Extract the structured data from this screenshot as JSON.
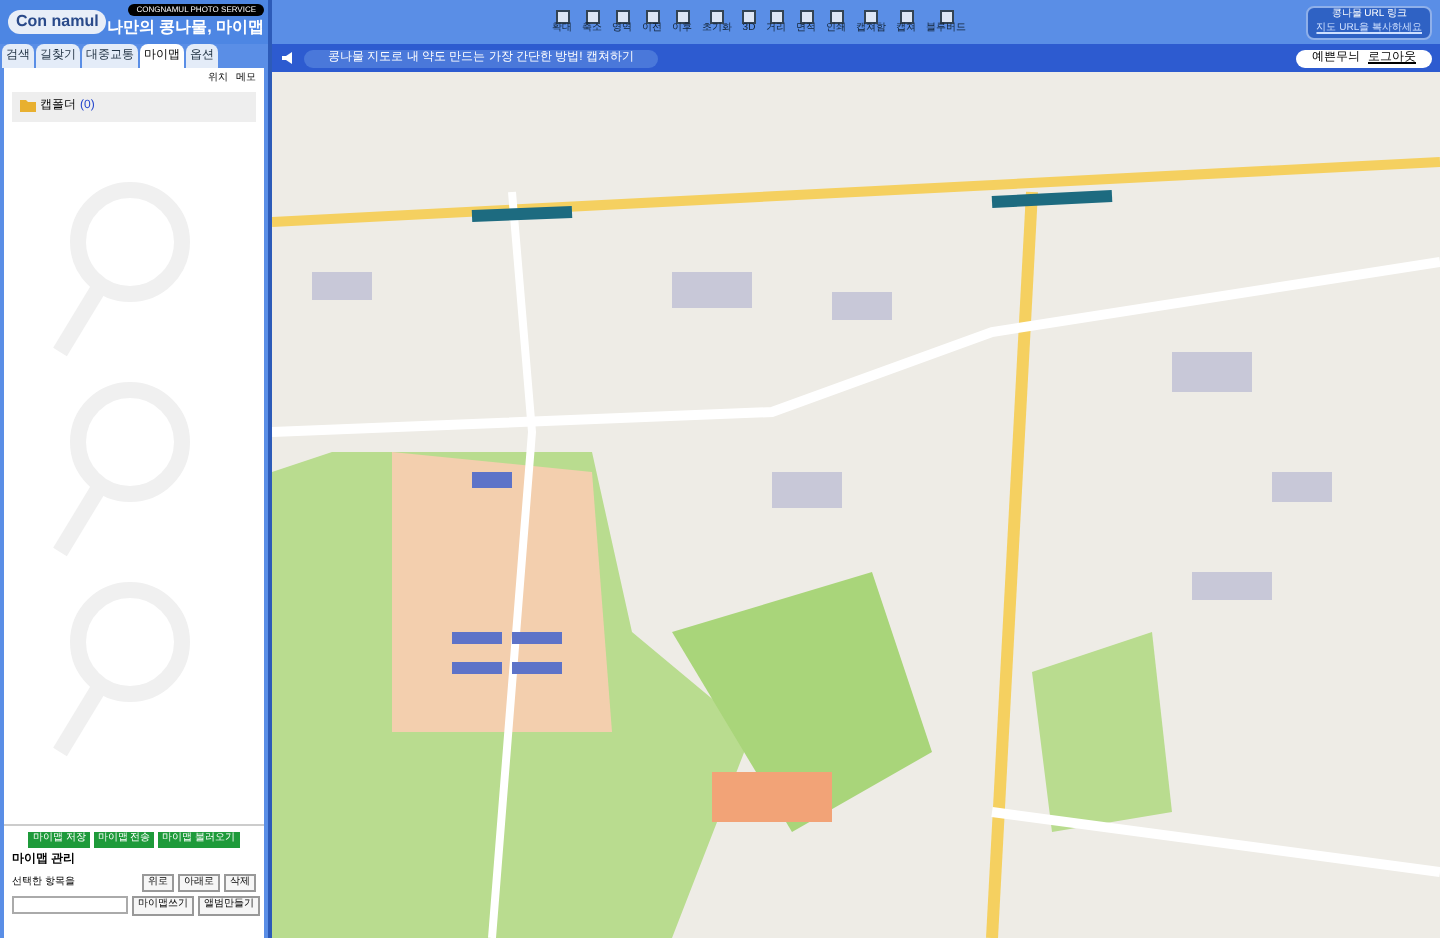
{
  "logo": {
    "text": "Con namul",
    "tagline": "CONGNAMUL PHOTO SERVICE",
    "title": "나만의 콩나물, 마이맵"
  },
  "tabs": [
    {
      "label": "검색",
      "selected": false
    },
    {
      "label": "길찾기",
      "selected": false
    },
    {
      "label": "대중교통",
      "selected": false
    },
    {
      "label": "마이맵",
      "selected": true
    },
    {
      "label": "옵션",
      "selected": false
    }
  ],
  "panel_links": [
    "위치",
    "메모"
  ],
  "folders": [
    {
      "name": "캡폴더",
      "count": "(0)"
    }
  ],
  "toolbar": [
    {
      "label": "확대"
    },
    {
      "label": "축소"
    },
    {
      "label": "영역"
    },
    {
      "label": "이전"
    },
    {
      "label": "이후"
    },
    {
      "label": "초기화"
    },
    {
      "label": "3D"
    },
    {
      "label": "거리"
    },
    {
      "label": "면적"
    },
    {
      "label": "인쇄"
    },
    {
      "label": "캡쳐함"
    },
    {
      "label": "캡쳐"
    },
    {
      "label": "블루버드"
    }
  ],
  "url_box": {
    "title": "콩나물 URL 링크",
    "link": "지도 URL을 복사하세요"
  },
  "banner": "콩나물 지도로 내 약도 만드는 가장 간단한 방법! 캡쳐하기",
  "user": {
    "name": "예쁜무늬",
    "logout": "로그아웃"
  },
  "bottom_buttons": [
    "마이맵 저장",
    "마이맵 전송",
    "마이맵 불러오기"
  ],
  "manage": {
    "title": "마이맵 관리",
    "label": "선택한 항목을",
    "actions": [
      "위로",
      "아래로",
      "삭제"
    ],
    "buttons": [
      "마이맵쓰기",
      "앨범만들기"
    ]
  }
}
